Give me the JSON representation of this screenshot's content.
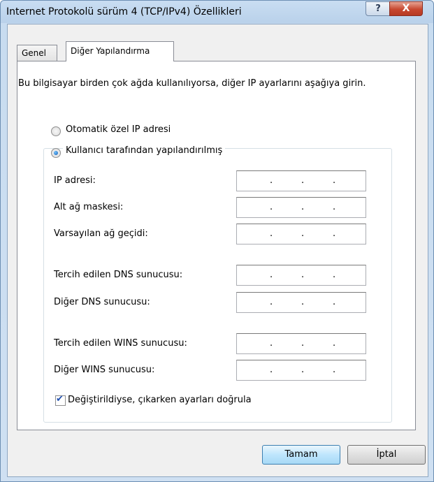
{
  "window": {
    "title": "Internet Protokolü sürüm 4 (TCP/IPv4) Özellikleri",
    "help_label": "?",
    "close_label": "X"
  },
  "tabs": [
    {
      "label": "Genel",
      "selected": false
    },
    {
      "label": "Diğer Yapılandırma",
      "selected": true
    }
  ],
  "description": "Bu bilgisayar birden çok ağda kullanılıyorsa, diğer IP ayarlarını aşağıya girin.",
  "radios": [
    {
      "label": "Otomatik özel IP adresi",
      "checked": false
    },
    {
      "label": "Kullanıcı tarafından yapılandırılmış",
      "checked": true
    }
  ],
  "fields": {
    "ip": {
      "label": "IP adresi:",
      "value": ". . ."
    },
    "mask": {
      "label": "Alt ağ maskesi:",
      "value": ". . ."
    },
    "gateway": {
      "label": "Varsayılan ağ geçidi:",
      "value": ". . ."
    },
    "dns_pref": {
      "label": "Tercih edilen DNS sunucusu:",
      "value": ". . ."
    },
    "dns_alt": {
      "label": "Diğer DNS sunucusu:",
      "value": ". . ."
    },
    "wins_pref": {
      "label": "Tercih edilen WINS sunucusu:",
      "value": ". . ."
    },
    "wins_alt": {
      "label": "Diğer WINS sunucusu:",
      "value": ". . ."
    }
  },
  "validate_checkbox": {
    "label": "Değiştirildiyse, çıkarken ayarları doğrula",
    "checked": true
  },
  "buttons": {
    "ok": "Tamam",
    "cancel": "İptal"
  }
}
